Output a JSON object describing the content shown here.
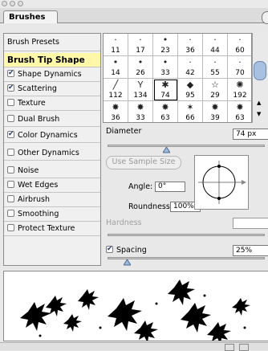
{
  "panel": {
    "tab_title": "Brushes",
    "menu_icon": "palette-menu-arrow-icon"
  },
  "left_list": {
    "presets_label": "Brush Presets",
    "active_label": "Brush Tip Shape",
    "options": [
      {
        "label": "Shape Dynamics",
        "checked": true
      },
      {
        "label": "Scattering",
        "checked": true
      },
      {
        "label": "Texture",
        "checked": false
      },
      {
        "label": "Dual Brush",
        "checked": false
      },
      {
        "label": "Color Dynamics",
        "checked": true
      },
      {
        "label": "Other Dynamics",
        "checked": false
      },
      {
        "label": "Noise",
        "checked": false
      },
      {
        "label": "Wet Edges",
        "checked": false
      },
      {
        "label": "Airbrush",
        "checked": false
      },
      {
        "label": "Smoothing",
        "checked": false
      },
      {
        "label": "Protect Texture",
        "checked": false
      }
    ]
  },
  "brush_grid": {
    "rows": [
      [
        {
          "size": "11"
        },
        {
          "size": "17"
        },
        {
          "size": "23"
        },
        {
          "size": "36"
        },
        {
          "size": "44"
        },
        {
          "size": "60"
        }
      ],
      [
        {
          "size": "14"
        },
        {
          "size": "26"
        },
        {
          "size": "33"
        },
        {
          "size": "42"
        },
        {
          "size": "55"
        },
        {
          "size": "70"
        }
      ],
      [
        {
          "size": "112"
        },
        {
          "size": "134"
        },
        {
          "size": "74"
        },
        {
          "size": "95"
        },
        {
          "size": "29"
        },
        {
          "size": "192"
        }
      ],
      [
        {
          "size": "36"
        },
        {
          "size": "33"
        },
        {
          "size": "63"
        },
        {
          "size": "66"
        },
        {
          "size": "39"
        },
        {
          "size": "63"
        }
      ]
    ],
    "selected_row": 2,
    "selected_col": 2
  },
  "diameter": {
    "label": "Diameter",
    "value": "74 px",
    "slider_fraction": 0.37
  },
  "sample_button": "Use Sample Size",
  "angle": {
    "label": "Angle:",
    "value": "0°"
  },
  "roundness": {
    "label": "Roundness:",
    "value": "100%"
  },
  "hardness": {
    "label": "Hardness",
    "value": ""
  },
  "spacing": {
    "label": "Spacing",
    "checked": true,
    "value": "25%",
    "slider_fraction": 0.12
  }
}
